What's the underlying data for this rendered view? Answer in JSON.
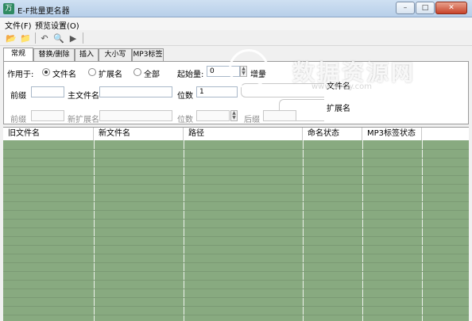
{
  "window": {
    "title": "E-F批量更名器",
    "icon_glyph": "万",
    "buttons": [
      "–",
      "□",
      "✕"
    ]
  },
  "menu": [
    "文件(F)",
    "预览设置(O)"
  ],
  "toolbar": {
    "icons": [
      "open-folder-icon",
      "open-file-icon",
      "undo-icon",
      "search-icon",
      "play-icon"
    ],
    "glyphs": [
      "📂",
      "📁",
      "↶",
      "🔍",
      "▶"
    ]
  },
  "tabs": [
    "常规",
    "替换/删除",
    "插入",
    "大小写",
    "MP3标签"
  ],
  "form": {
    "apply_to_label": "作用于:",
    "radio_options": [
      "文件名",
      "扩展名",
      "全部"
    ],
    "start_label": "起始量:",
    "start_value": "0",
    "step_label": "增量",
    "prefix_label": "前缀",
    "main_name_label": "主文件名",
    "digits_label": "位数",
    "digits_value": "1",
    "ext_prefix_label": "前缀",
    "new_ext_label": "新扩展名",
    "ext_digits_label": "位数",
    "suffix_label": "后缀",
    "group_filename": "文件名",
    "group_ext": "扩展名",
    "values": {
      "prefix": "",
      "main_name": "",
      "ext_prefix": "",
      "new_ext": "",
      "suffix": ""
    }
  },
  "table": {
    "columns": [
      "旧文件名",
      "新文件名",
      "路径",
      "命名状态",
      "MP3标签状态"
    ],
    "rows": []
  },
  "watermark": {
    "text": "数据资源网",
    "url": "www.smzy.com"
  },
  "colors": {
    "grid_body": "#88aa80",
    "title_bar": "#b7cfe9"
  }
}
